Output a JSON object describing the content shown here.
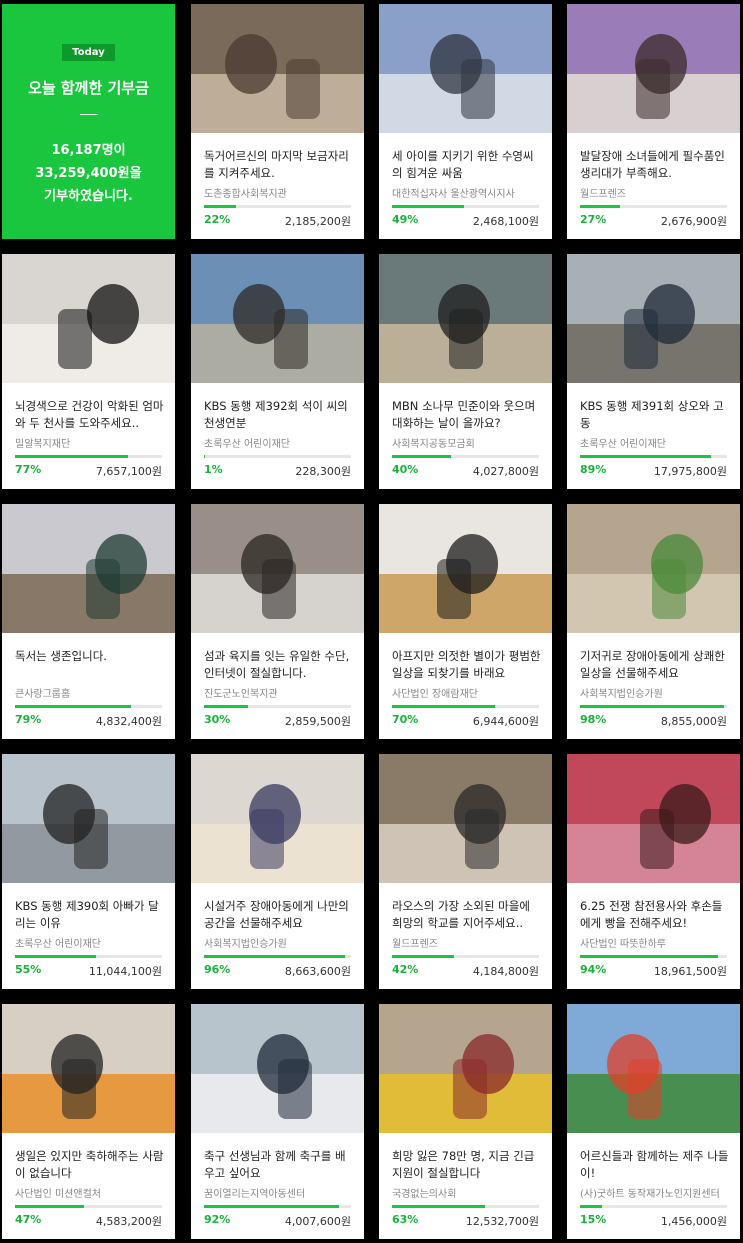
{
  "hero": {
    "badge": "Today",
    "title": "오늘 함께한 기부금",
    "line1": "16,187명이",
    "line2": "33,259,400원을",
    "line3": "기부하였습니다."
  },
  "colors": {
    "accent": "#19c63e",
    "hero_bg": "#19c63e"
  },
  "cards": [
    {
      "title": "독거어르신의 마지막 보금자리를 지켜주세요.",
      "org": "도촌종합사회복지관",
      "percent": "22%",
      "ratio": 0.22,
      "amount": "2,185,200원",
      "palette": [
        "#7a6a5a",
        "#c9b9a5",
        "#4a3a30"
      ]
    },
    {
      "title": "세 아이를 지키기 위한 수영씨의 힘겨운 싸움",
      "org": "대한적십자사 울산광역시지사",
      "percent": "49%",
      "ratio": 0.49,
      "amount": "2,468,100원",
      "palette": [
        "#8aa0c8",
        "#dde3ea",
        "#2f3440"
      ]
    },
    {
      "title": "발달장애 소녀들에게 필수품인 생리대가 부족해요.",
      "org": "월드프렌즈",
      "percent": "27%",
      "ratio": 0.27,
      "amount": "2,676,900원",
      "palette": [
        "#9a7db8",
        "#e3ddd5",
        "#3a2a2a"
      ]
    },
    {
      "title": "뇌경색으로 건강이 악화된 엄마와 두 천사를 도와주세요..",
      "org": "밀알복지재단",
      "percent": "77%",
      "ratio": 0.77,
      "amount": "7,657,100원",
      "palette": [
        "#d9d6d2",
        "#f2f0ec",
        "#111111"
      ]
    },
    {
      "title": "KBS 동행 제392회 석이 씨의 천생연분",
      "org": "초록우산 어린이재단",
      "percent": "1%",
      "ratio": 0.01,
      "amount": "228,300원",
      "palette": [
        "#6b8fb5",
        "#b9b2a0",
        "#2e2a25"
      ]
    },
    {
      "title": "MBN 소나무 민준이와 웃으며 대화하는 날이 올까요?",
      "org": "사회복지공동모금회",
      "percent": "40%",
      "ratio": 0.4,
      "amount": "4,027,800원",
      "palette": [
        "#6a7a7a",
        "#c9b89c",
        "#1f1f1f"
      ]
    },
    {
      "title": "KBS 동행 제391회 상오와 고동",
      "org": "초록우산 어린이재단",
      "percent": "89%",
      "ratio": 0.89,
      "amount": "17,975,800원",
      "palette": [
        "#a7b0b5",
        "#6e6a62",
        "#1f2a3a"
      ]
    },
    {
      "title": "독서는 생존입니다.",
      "org": "큰사랑그룹홈",
      "percent": "79%",
      "ratio": 0.79,
      "amount": "4,832,400원",
      "palette": [
        "#c9c9cf",
        "#7d6a55",
        "#1f3b33"
      ]
    },
    {
      "title": "섬과 육지를 잇는 유일한 수단, 인터넷이 절실합니다.",
      "org": "진도군노인복지관",
      "percent": "30%",
      "ratio": 0.3,
      "amount": "2,859,500원",
      "palette": [
        "#9a8f88",
        "#e0dfdc",
        "#2a2522"
      ]
    },
    {
      "title": "아프지만 의젓한 별이가 평범한 일상을 되찾기를 바래요",
      "org": "사단법인 장애람재단",
      "percent": "70%",
      "ratio": 0.7,
      "amount": "6,944,600원",
      "palette": [
        "#e9e6e1",
        "#c99a55",
        "#1c1c1c"
      ]
    },
    {
      "title": "기저귀로 장애아동에게 상쾌한 일상을 선물해주세요",
      "org": "사회복지법인승가원",
      "percent": "98%",
      "ratio": 0.98,
      "amount": "8,855,000원",
      "palette": [
        "#b5a58e",
        "#d8cbb6",
        "#4a8a3a"
      ]
    },
    {
      "title": "KBS 동행 제390회 아빠가 달리는 이유",
      "org": "초록우산 어린이재단",
      "percent": "55%",
      "ratio": 0.55,
      "amount": "11,044,100원",
      "palette": [
        "#b9c3cc",
        "#8c9298",
        "#222222"
      ]
    },
    {
      "title": "시설거주 장애아동에게 나만의 공간을 선물해주세요",
      "org": "사회복지법인승가원",
      "percent": "96%",
      "ratio": 0.96,
      "amount": "8,663,600원",
      "palette": [
        "#dcd7d0",
        "#efe4d2",
        "#3a3a60"
      ]
    },
    {
      "title": "라오스의 가장 소외된 마을에 희망의 학교를 지어주세요..",
      "org": "월드프렌즈",
      "percent": "42%",
      "ratio": 0.42,
      "amount": "4,184,800원",
      "palette": [
        "#8a7a68",
        "#d9d0c2",
        "#2a2a2a"
      ]
    },
    {
      "title": "6.25 전쟁 참전용사와 후손들에게 빵을 전해주세요!",
      "org": "사단법인 따뜻한하루",
      "percent": "94%",
      "ratio": 0.94,
      "amount": "18,961,500원",
      "palette": [
        "#c0485a",
        "#d88fa0",
        "#3a1a1a"
      ]
    },
    {
      "title": "생일은 있지만 축하해주는 사람이 없습니다",
      "org": "사단법인 미션앤컬처",
      "percent": "47%",
      "ratio": 0.47,
      "amount": "4,583,200원",
      "palette": [
        "#d7cfc3",
        "#e98f2a",
        "#222222"
      ]
    },
    {
      "title": "축구 선생님과 함께 축구를 배우고 싶어요",
      "org": "꿈이열리는지역아동센터",
      "percent": "92%",
      "ratio": 0.92,
      "amount": "4,007,600원",
      "palette": [
        "#b8c4cc",
        "#eef0f2",
        "#1f2a3a"
      ]
    },
    {
      "title": "희망 잃은 78만 명, 지금 긴급 지원이 절실합니다",
      "org": "국경없는의사회",
      "percent": "63%",
      "ratio": 0.63,
      "amount": "12,532,700원",
      "palette": [
        "#b5a48e",
        "#e8c12a",
        "#8a2a2a"
      ]
    },
    {
      "title": "어르신들과 함께하는 제주 나들이!",
      "org": "(사)굿하트 동작재가노인지원센터",
      "percent": "15%",
      "ratio": 0.15,
      "amount": "1,456,000원",
      "palette": [
        "#7fa9d6",
        "#3f8a3a",
        "#e0402a"
      ]
    }
  ]
}
